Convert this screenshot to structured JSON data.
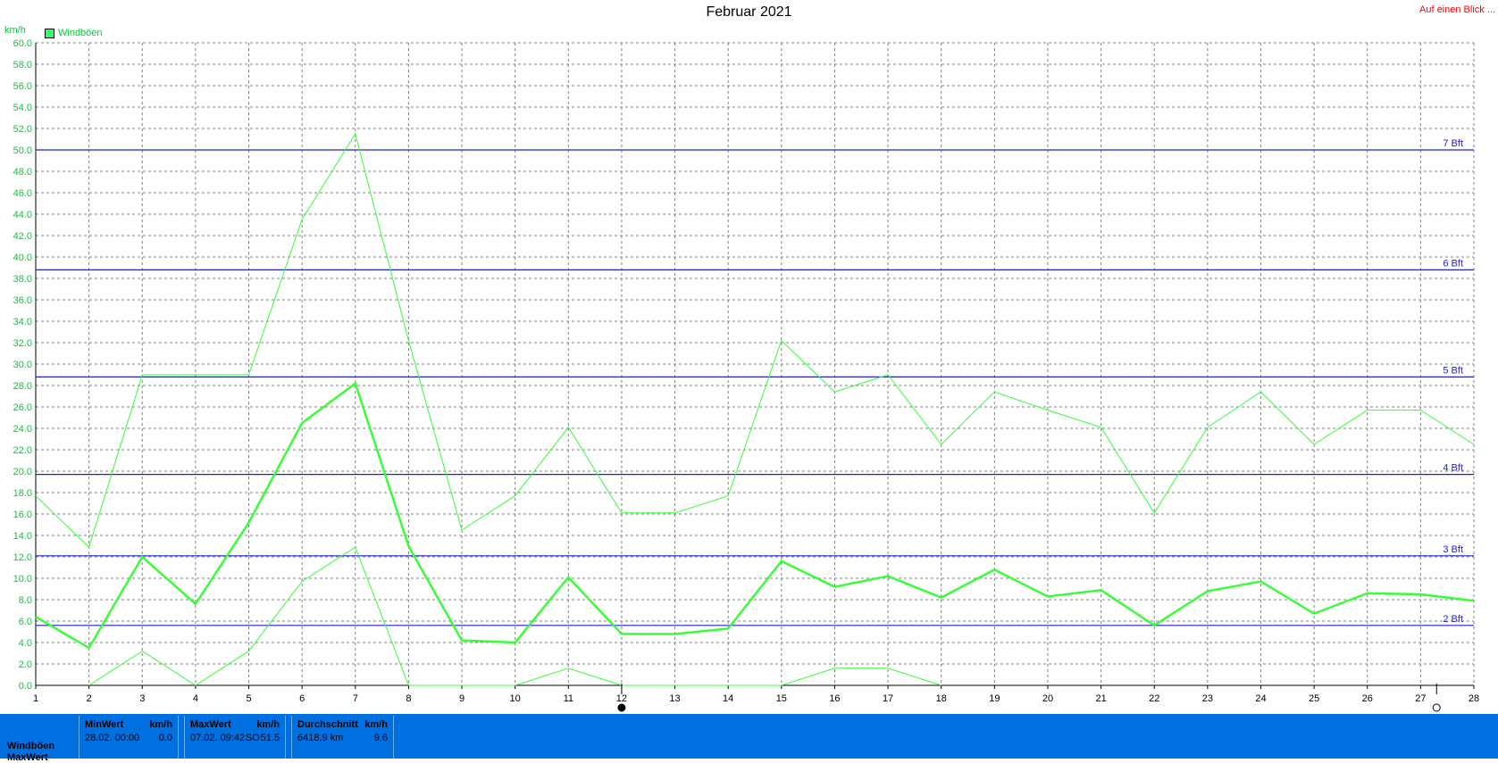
{
  "header": {
    "title": "Februar 2021",
    "top_right_link": "Auf einen Blick ...",
    "unit": "km/h",
    "legend_label": "Windböen"
  },
  "colors": {
    "series": "#33ff33",
    "reference_lines": "#2222cc",
    "grid": "#808080",
    "footer": "#0070e0",
    "link": "#ff0000"
  },
  "chart_data": {
    "type": "line",
    "title": "Februar 2021",
    "ylabel": "km/h",
    "xlim": [
      1,
      28
    ],
    "ylim": [
      0,
      60
    ],
    "y_ticks": [
      "0.0",
      "2.0",
      "4.0",
      "6.0",
      "8.0",
      "10.0",
      "12.0",
      "14.0",
      "16.0",
      "18.0",
      "20.0",
      "22.0",
      "24.0",
      "26.0",
      "28.0",
      "30.0",
      "32.0",
      "34.0",
      "36.0",
      "38.0",
      "40.0",
      "42.0",
      "44.0",
      "46.0",
      "48.0",
      "50.0",
      "52.0",
      "54.0",
      "56.0",
      "58.0",
      "60.0"
    ],
    "x_ticks": [
      "1",
      "2",
      "3",
      "4",
      "5",
      "6",
      "7",
      "8",
      "9",
      "10",
      "11",
      "12",
      "13",
      "14",
      "15",
      "16",
      "17",
      "18",
      "19",
      "20",
      "21",
      "22",
      "23",
      "24",
      "25",
      "26",
      "27",
      "28"
    ],
    "grid": true,
    "legend": "top-left",
    "series": [
      {
        "name": "Windböen",
        "role": "mean",
        "x": [
          1,
          2,
          3,
          4,
          5,
          6,
          7,
          8,
          9,
          10,
          11,
          12,
          13,
          14,
          15,
          16,
          17,
          18,
          19,
          20,
          21,
          22,
          23,
          24,
          25,
          26,
          27,
          28
        ],
        "values": [
          6.4,
          3.5,
          12.0,
          7.6,
          15.2,
          24.5,
          28.2,
          13.0,
          4.2,
          4.0,
          10.1,
          4.8,
          4.8,
          5.3,
          11.6,
          9.2,
          10.2,
          8.2,
          10.8,
          8.3,
          8.9,
          5.6,
          8.8,
          9.7,
          6.7,
          8.6,
          8.5,
          7.9
        ]
      },
      {
        "role": "max",
        "x": [
          1,
          2,
          3,
          4,
          5,
          6,
          7,
          8,
          9,
          10,
          11,
          12,
          13,
          14,
          15,
          16,
          17,
          18,
          19,
          20,
          21,
          22,
          23,
          24,
          25,
          26,
          27,
          28
        ],
        "values": [
          17.7,
          12.9,
          29.0,
          29.0,
          29.0,
          43.5,
          51.5,
          32.2,
          14.5,
          17.7,
          24.1,
          16.1,
          16.1,
          17.7,
          32.2,
          27.4,
          29.0,
          22.5,
          27.4,
          25.7,
          24.1,
          16.1,
          24.1,
          27.4,
          22.5,
          25.7,
          25.7,
          22.5
        ]
      },
      {
        "role": "min",
        "x": [
          2,
          3,
          4,
          5,
          6,
          7,
          8,
          10,
          11,
          12,
          15,
          16,
          17,
          18
        ],
        "values": [
          0.0,
          3.2,
          0.0,
          3.2,
          9.7,
          12.9,
          0.0,
          0.0,
          1.6,
          0.0,
          0.0,
          1.6,
          1.6,
          0.0
        ]
      }
    ],
    "reference_lines": [
      {
        "label": "2 Bft",
        "value": 5.6
      },
      {
        "label": "3 Bft",
        "value": 12.1
      },
      {
        "label": "4 Bft",
        "value": 19.7
      },
      {
        "label": "5 Bft",
        "value": 28.8
      },
      {
        "label": "6 Bft",
        "value": 38.8
      },
      {
        "label": "7 Bft",
        "value": 50.0
      }
    ],
    "moon_phases": [
      {
        "day": 12,
        "phase": "new-moon"
      },
      {
        "day": 27.3,
        "phase": "full-moon"
      }
    ]
  },
  "footer": {
    "row_label_1": "Windböen",
    "row_label_2": "MaxWert",
    "min": {
      "head_label": "MinWert",
      "head_unit": "km/h",
      "time": "28.02.  00:00",
      "value": "0.0"
    },
    "max": {
      "head_label": "MaxWert",
      "head_unit": "km/h",
      "time": "07.02.  09:42",
      "dir": "SO",
      "value": "51.5"
    },
    "avg": {
      "head_label": "Durchschnitt",
      "head_unit": "km/h",
      "distance": "6418.9 km",
      "value": "9.6"
    }
  }
}
